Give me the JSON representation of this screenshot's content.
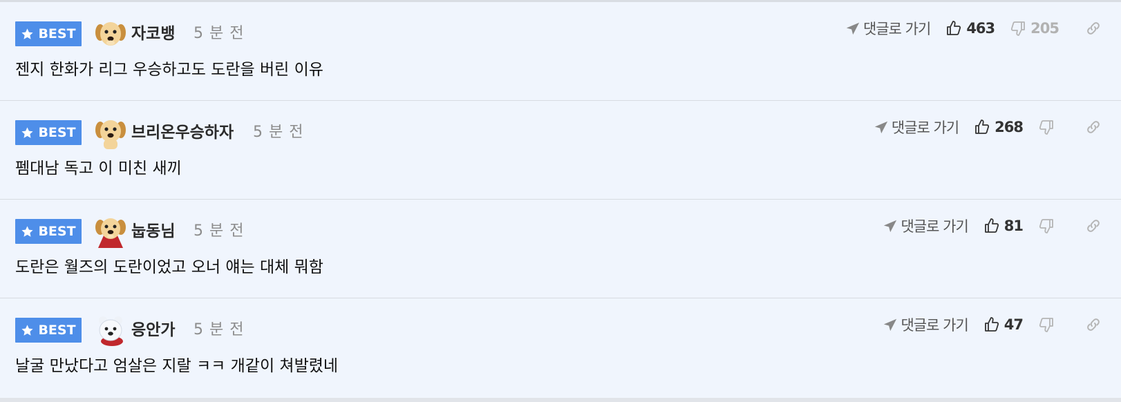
{
  "colors": {
    "badge": "#4e8ee9",
    "background": "#f0f5fd",
    "muted": "#8c8c8c"
  },
  "comments": [
    {
      "badge": "BEST",
      "nickname": "자코뱅",
      "time": "5 분 전",
      "goto_label": "댓글로 가기",
      "likes": "463",
      "dislikes": "205",
      "avatar": "puppy-avatar",
      "text": "젠지 한화가 리그 우승하고도 도란을 버린 이유"
    },
    {
      "badge": "BEST",
      "nickname": "브리온우승하자",
      "time": "5 분 전",
      "goto_label": "댓글로 가기",
      "likes": "268",
      "dislikes": "",
      "avatar": "puppy-avatar",
      "text": "펨대남 독고 이 미친 새끼"
    },
    {
      "badge": "BEST",
      "nickname": "눕동님",
      "time": "5 분 전",
      "goto_label": "댓글로 가기",
      "likes": "81",
      "dislikes": "",
      "avatar": "puppy-cape-avatar",
      "text": "도란은 월즈의 도란이었고 오너 얘는 대체 뭐함"
    },
    {
      "badge": "BEST",
      "nickname": "응안가",
      "time": "5 분 전",
      "goto_label": "댓글로 가기",
      "likes": "47",
      "dislikes": "",
      "avatar": "white-bear-avatar",
      "text": "날굴 만났다고 엄살은 지랄 ㅋㅋ 개같이 쳐발렸네"
    }
  ]
}
